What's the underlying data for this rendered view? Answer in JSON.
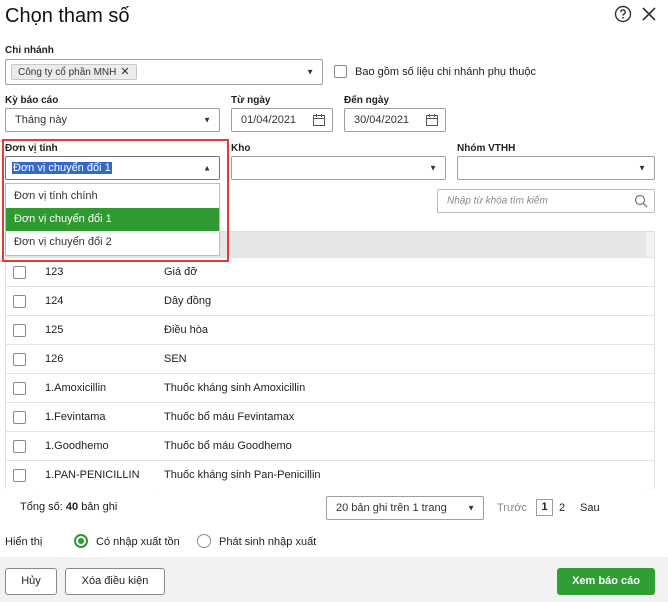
{
  "dialog": {
    "title": "Chọn tham số"
  },
  "icons": {
    "help": "help-circle-icon",
    "close": "close-icon"
  },
  "branch": {
    "label": "Chi nhánh",
    "tag": "Công ty cổ phần MNH",
    "include_label": "Bao gồm số liệu chi nhánh phụ thuộc"
  },
  "period": {
    "label": "Kỳ báo cáo",
    "value": "Tháng này"
  },
  "from_date": {
    "label": "Từ ngày",
    "value": "01/04/2021"
  },
  "to_date": {
    "label": "Đến ngày",
    "value": "30/04/2021"
  },
  "unit": {
    "label": "Đơn vị tính",
    "value": "Đơn vị chuyển đổi 1",
    "options": [
      "Đơn vị tính chính",
      "Đơn vị chuyển đổi 1",
      "Đơn vị chuyển đổi 2"
    ],
    "selected_index": 1
  },
  "warehouse": {
    "label": "Kho"
  },
  "group": {
    "label": "Nhóm VTHH"
  },
  "search": {
    "placeholder": "Nhập từ khóa tìm kiếm"
  },
  "table": {
    "rows": [
      {
        "code": "123",
        "name": "Giá đỡ"
      },
      {
        "code": "124",
        "name": "Dây đồng"
      },
      {
        "code": "125",
        "name": "Điều hòa"
      },
      {
        "code": "126",
        "name": "SEN"
      },
      {
        "code": "1.Amoxicillin",
        "name": "Thuốc kháng sinh  Amoxicillin"
      },
      {
        "code": "1.Fevintama",
        "name": "Thuốc bổ máu Fevintamax"
      },
      {
        "code": "1.Goodhemo",
        "name": "Thuốc bổ máu Goodhemo"
      },
      {
        "code": "1.PAN-PENICILLIN",
        "name": "Thuốc kháng sinh Pan-Penicillin"
      }
    ]
  },
  "pagination": {
    "total_label": "Tổng số:",
    "total_count": "40",
    "total_unit": "bản ghi",
    "page_size": "20 bản ghi trên 1 trang",
    "prev": "Trước",
    "page1": "1",
    "page2": "2",
    "next": "Sau"
  },
  "display": {
    "label": "Hiển thị",
    "option1": "Có nhập xuất tồn",
    "option2": "Phát sinh nhập xuất"
  },
  "buttons": {
    "cancel": "Hủy",
    "clear": "Xóa điều kiện",
    "view": "Xem báo cáo"
  },
  "colors": {
    "accent": "#2e9a2f",
    "highlight": "#3569c8",
    "frame": "#e53935"
  }
}
